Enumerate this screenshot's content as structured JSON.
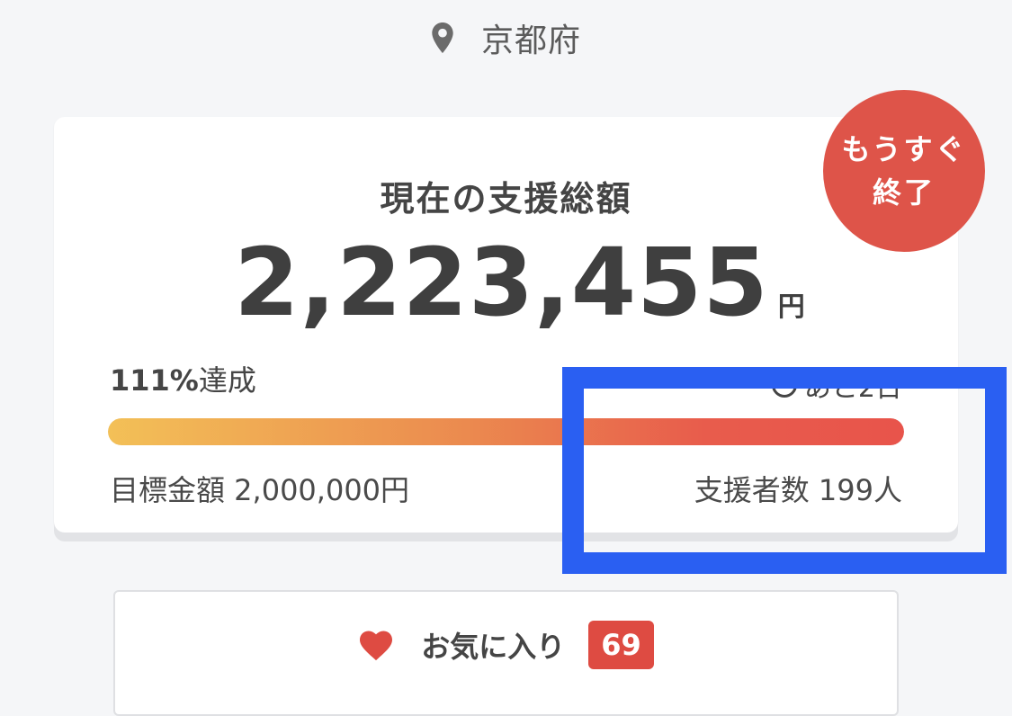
{
  "location": {
    "icon": "map-pin-icon",
    "text": "京都府"
  },
  "card": {
    "heading": "現在の支援総額",
    "amount": "2,223,455",
    "currency": "円",
    "achievement_pct": "111%",
    "achievement_suffix": "達成",
    "progress_fraction": 1.0,
    "remaining_icon": "clock-icon",
    "remaining_text": "あと2日",
    "goal_label": "目標金額 2,000,000円",
    "supporters_label": "支援者数 199人"
  },
  "badge": {
    "line1": "もうすぐ",
    "line2": "終了",
    "color": "#de5449"
  },
  "favorite": {
    "icon": "heart-icon",
    "label": "お気に入り",
    "count": "69"
  },
  "colors": {
    "highlight_border": "#2a5ff2",
    "progress_start": "#f3c057",
    "progress_end": "#e8544b",
    "accent_red": "#de4b42"
  }
}
